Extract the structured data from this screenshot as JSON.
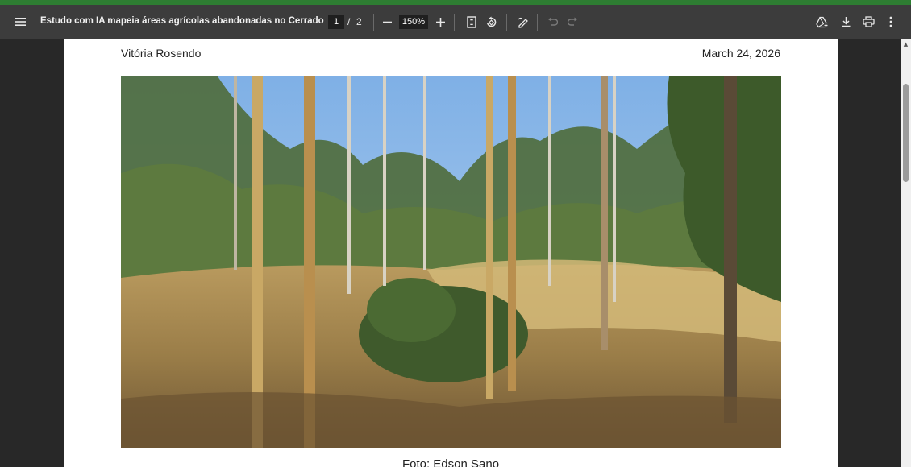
{
  "toolbar": {
    "title": "Estudo com IA mapeia áreas agrícolas abandonadas no Cerrado",
    "current_page": "1",
    "page_separator": "/",
    "total_pages": "2",
    "zoom": "150%",
    "icons": {
      "menu": "menu-icon",
      "zoom_out": "minus-icon",
      "zoom_in": "plus-icon",
      "fit": "fit-page-icon",
      "rotate": "rotate-icon",
      "annotate": "annotate-pen-icon",
      "undo": "undo-icon",
      "redo": "redo-icon",
      "drive": "add-to-drive-icon",
      "download": "download-icon",
      "print": "print-icon",
      "more": "more-vertical-icon"
    }
  },
  "document": {
    "author": "Vitória Rosendo",
    "date": "March 24, 2026",
    "photo_caption": "Foto: Edson Sano"
  },
  "colors": {
    "toolbar_bg": "#3c3c3c",
    "accent": "#2e7d32",
    "viewer_bg": "#282828",
    "page_bg": "#ffffff"
  }
}
